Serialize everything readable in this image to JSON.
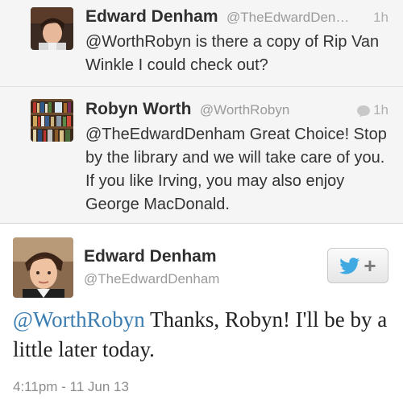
{
  "replies": [
    {
      "name": "Edward Denham",
      "handle": "@TheEdwardDen…",
      "time": "1h",
      "text": "@WorthRobyn is there a copy of Rip Van Winkle I could check out?",
      "avatar": "edward-photo"
    },
    {
      "name": "Robyn Worth",
      "handle": "@WorthRobyn",
      "time": "1h",
      "text": "@TheEdwardDenham Great Choice! Stop by the library and we will take care of you. If you like Irving, you may also enjoy George MacDonald.",
      "avatar": "bookshelf-photo",
      "has_reply_icon": true
    }
  ],
  "main_tweet": {
    "name": "Edward Denham",
    "handle": "@TheEdwardDenham",
    "mention": "@WorthRobyn",
    "text": " Thanks, Robyn! I'll be by a little later today.",
    "timestamp": "4:11pm - 11 Jun 13",
    "follow_icon": "twitter-bird-plus-icon"
  },
  "colors": {
    "mention": "#3b7db1",
    "twitter_bird": "#41a9e1",
    "reply_bg": "#f5f5f5"
  }
}
